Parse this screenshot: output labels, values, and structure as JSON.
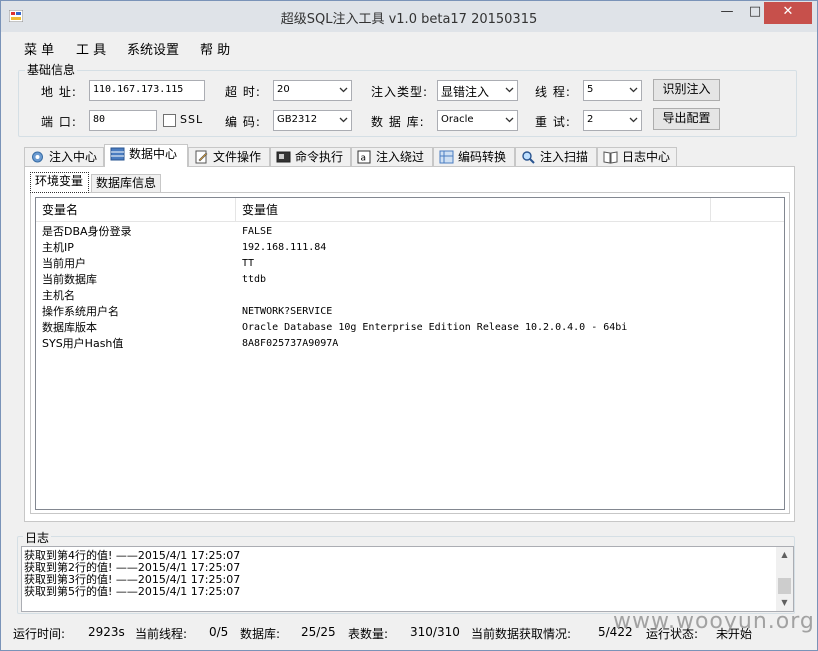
{
  "window": {
    "title": "超级SQL注入工具 v1.0 beta17 20150315",
    "min_glyph": "—",
    "max_glyph": "□",
    "close_glyph": "✕"
  },
  "menu": [
    "菜 单",
    "工 具",
    "系统设置",
    "帮 助"
  ],
  "basic": {
    "legend": "基础信息",
    "address_label": "地 址:",
    "address_value": "110.167.173.115",
    "port_label": "端 口:",
    "port_value": "80",
    "ssl_label": "SSL",
    "timeout_label": "超 时:",
    "timeout_value": "20",
    "encoding_label": "编 码:",
    "encoding_value": "GB2312",
    "inject_type_label": "注入类型:",
    "inject_type_value": "显错注入",
    "database_label": "数 据 库:",
    "database_value": "Oracle",
    "threads_label": "线 程:",
    "threads_value": "5",
    "retry_label": "重 试:",
    "retry_value": "2",
    "identify_button": "识别注入",
    "export_button": "导出配置"
  },
  "tabs": [
    "注入中心",
    "数据中心",
    "文件操作",
    "命令执行",
    "注入绕过",
    "编码转换",
    "注入扫描",
    "日志中心"
  ],
  "subtabs": [
    "环境变量",
    "数据库信息"
  ],
  "table": {
    "headers": [
      "变量名",
      "变量值"
    ],
    "rows": [
      [
        "是否DBA身份登录",
        "FALSE"
      ],
      [
        "主机IP",
        "192.168.111.84"
      ],
      [
        "当前用户",
        "TT"
      ],
      [
        "当前数据库",
        "ttdb"
      ],
      [
        "主机名",
        ""
      ],
      [
        "操作系统用户名",
        "NETWORK?SERVICE"
      ],
      [
        "数据库版本",
        "Oracle Database 10g Enterprise Edition Release 10.2.0.4.0 - 64bi"
      ],
      [
        "SYS用户Hash值",
        "8A8F025737A9097A"
      ]
    ]
  },
  "log": {
    "title": "日志",
    "lines": [
      "获取到第4行的值! ——2015/4/1 17:25:07",
      "获取到第2行的值! ——2015/4/1 17:25:07",
      "获取到第3行的值! ——2015/4/1 17:25:07",
      "获取到第5行的值! ——2015/4/1 17:25:07"
    ]
  },
  "status": {
    "runtime_label": "运行时间:",
    "runtime_value": "2923s",
    "threads_label": "当前线程:",
    "threads_value": "0/5",
    "db_label": "数据库:",
    "db_value": "25/25",
    "tables_label": "表数量:",
    "tables_value": "310/310",
    "fetch_label": "当前数据获取情况:",
    "fetch_value": "5/422",
    "state_label": "运行状态:",
    "state_value": "未开始"
  },
  "watermark": "www.wooyun.org",
  "colors": {
    "close_button": "#c7504b",
    "accent": "#3c7fb1"
  }
}
